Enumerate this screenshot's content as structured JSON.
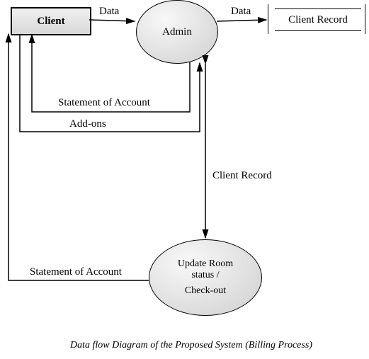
{
  "nodes": {
    "client": "Client",
    "admin": "Admin",
    "client_record": "Client Record",
    "update_line1": "Update Room",
    "update_line2": "status /",
    "update_line3": "Check-out"
  },
  "edges": {
    "client_to_admin": "Data",
    "admin_to_record": "Data",
    "admin_to_client_stmt": "Statement of Account",
    "client_to_admin_addons": "Add-ons",
    "admin_update_record": "Client Record",
    "update_to_client": "Statement of Account"
  },
  "caption": "Data flow Diagram of the Proposed System (Billing Process)",
  "chart_data": {
    "type": "table",
    "title": "Data flow Diagram of the Proposed System (Billing Process)",
    "nodes": [
      {
        "id": "client",
        "label": "Client",
        "kind": "external-entity"
      },
      {
        "id": "admin",
        "label": "Admin",
        "kind": "process"
      },
      {
        "id": "client_record",
        "label": "Client Record",
        "kind": "data-store"
      },
      {
        "id": "update",
        "label": "Update Room status / Check-out",
        "kind": "process"
      }
    ],
    "flows": [
      {
        "from": "client",
        "to": "admin",
        "label": "Data"
      },
      {
        "from": "admin",
        "to": "client_record",
        "label": "Data"
      },
      {
        "from": "admin",
        "to": "client",
        "label": "Statement of Account"
      },
      {
        "from": "client",
        "to": "admin",
        "label": "Add-ons"
      },
      {
        "from": "admin",
        "to": "update",
        "label": "Client Record",
        "bidirectional": true
      },
      {
        "from": "update",
        "to": "client",
        "label": "Statement of Account"
      }
    ]
  }
}
